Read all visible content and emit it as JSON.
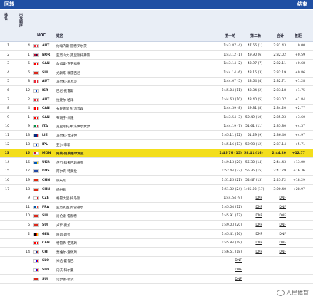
{
  "header": {
    "left_title": "回转",
    "right_title": "结束",
    "col_rank": "排名",
    "col_start": "出发顺序",
    "col_noc": "NOC",
    "col_name": "姓名",
    "col_run1": "第一轮",
    "col_run2": "第二轮",
    "col_total": "合计",
    "col_diff": "差距"
  },
  "rows": [
    {
      "rank": "1",
      "start": "4",
      "noc": "AUT",
      "name": "约翰内斯·施特罗尔茨",
      "run1": "1:43.87 (4)",
      "run2": "47.56 (1)",
      "total": "2:31.43",
      "diff": "0.00",
      "flag": [
        "#ed2939",
        "#ffffff",
        "#ed2939"
      ]
    },
    {
      "rank": "2",
      "start": "1",
      "noc": "NOR",
      "name": "亚历山大·克里斯托弗森",
      "run1": "1:43.12 (1)",
      "run2": "49.90 (6)",
      "total": "2:32.02",
      "diff": "+0.59",
      "flag": [
        "#ba0c2f",
        "#00205b",
        "#ba0c2f"
      ]
    },
    {
      "rank": "3",
      "start": "5",
      "noc": "CAN",
      "name": "詹姆斯·克劳福德",
      "run1": "1:43.14 (2)",
      "run2": "48.97 (7)",
      "total": "2:32.11",
      "diff": "+0.68",
      "flag": [
        "#ff0000",
        "#ffffff",
        "#ff0000"
      ]
    },
    {
      "rank": "4",
      "start": "6",
      "noc": "SUI",
      "name": "尤斯塔·穆雷西尼",
      "run1": "1:44.14 (6)",
      "run2": "48.15 (3)",
      "total": "2:32.19",
      "diff": "+0.86",
      "flag": [
        "#da291c",
        "#da291c",
        "#da291c"
      ]
    },
    {
      "rank": "5",
      "start": "8",
      "noc": "AUT",
      "name": "马尔科·施瓦茨",
      "run1": "1:44.07 (5)",
      "run2": "48.64 (4)",
      "total": "2:32.71",
      "diff": "+1.28",
      "flag": [
        "#ed2939",
        "#ffffff",
        "#ed2939"
      ]
    },
    {
      "rank": "6",
      "start": "12",
      "noc": "ISR",
      "name": "巴尼·托雷斯",
      "run1": "1:45.04 (11)",
      "run2": "48.34 (2)",
      "total": "2:33.18",
      "diff": "+1.75",
      "flag": [
        "#ffffff",
        "#0038b8",
        "#ffffff"
      ]
    },
    {
      "rank": "7",
      "start": "2",
      "noc": "AUT",
      "name": "拉斐尔·哈泽",
      "run1": "1:44.63 (10)",
      "run2": "48.40 (5)",
      "total": "2:33.07",
      "diff": "+1.84",
      "flag": [
        "#ed2939",
        "#ffffff",
        "#ed2939"
      ]
    },
    {
      "rank": "8",
      "start": "4",
      "noc": "CAN",
      "name": "布罗德里克·汤普森",
      "run1": "1:44.39 (8)",
      "run2": "49.81 (8)",
      "total": "2:34.20",
      "diff": "+2.77",
      "flag": [
        "#ff0000",
        "#ffffff",
        "#ff0000"
      ]
    },
    {
      "rank": "9",
      "start": "1",
      "noc": "CAN",
      "name": "布朗宁·佩隆",
      "run1": "1:43.54 (3)",
      "run2": "50.49 (10)",
      "total": "2:35.03",
      "diff": "+3.60",
      "flag": [
        "#ff0000",
        "#ffffff",
        "#ff0000"
      ]
    },
    {
      "rank": "10",
      "start": "9",
      "noc": "ITA",
      "name": "克里斯托弗·法伊尔默尔",
      "run1": "1:44.19 (7)",
      "run2": "51.61 (11)",
      "total": "2:35.80",
      "diff": "+4.37",
      "flag": [
        "#009246",
        "#ffffff",
        "#ce2b37"
      ]
    },
    {
      "rank": "11",
      "start": "13",
      "noc": "LIE",
      "name": "马尔科·普法伊",
      "run1": "1:45.11 (12)",
      "run2": "51.29 (9)",
      "total": "2:36.40",
      "diff": "+4.97",
      "flag": [
        "#002b7f",
        "#002b7f",
        "#ce1126"
      ]
    },
    {
      "rank": "12",
      "start": "18",
      "noc": "IPL",
      "name": "亚尔·菲耶",
      "run1": "1:45.16 (13)",
      "run2": "52.98 (12)",
      "total": "2:37.14",
      "diff": "+5.71",
      "flag": [
        "#ffffff",
        "#0038b8",
        "#ffffff"
      ]
    },
    {
      "rank": "13",
      "start": "15",
      "noc": "MON",
      "name": "阿莱·阿莱维尔泽亚",
      "run1": "1:45.79 (15)",
      "run2": "58.41 (16)",
      "total": "2:44.20",
      "diff": "+12.77",
      "flag": [
        "#ce1126",
        "#ffffff",
        "#ffffff"
      ],
      "highlight": true
    },
    {
      "rank": "14",
      "start": "16",
      "noc": "UKR",
      "name": "伊万·科夫巴斯纽克",
      "run1": "1:49.13 (20)",
      "run2": "55.30 (14)",
      "total": "2:44.43",
      "diff": "+13.00",
      "flag": [
        "#0057b7",
        "#0057b7",
        "#ffd700"
      ]
    },
    {
      "rank": "15",
      "start": "17",
      "noc": "KOS",
      "name": "阿尔宾·特莫拉",
      "run1": "1:52.44 (22)",
      "run2": "55.35 (15)",
      "total": "2:47.79",
      "diff": "+16.36",
      "flag": [
        "#244aa5",
        "#244aa5",
        "#244aa5"
      ]
    },
    {
      "rank": "16",
      "start": "19",
      "noc": "CHN",
      "name": "张天琪",
      "run1": "1:51.25 (21)",
      "run2": "54.47 (13)",
      "total": "2:45.72",
      "diff": "+18.29",
      "flag": [
        "#de2910",
        "#de2910",
        "#de2910"
      ]
    },
    {
      "rank": "17",
      "start": "18",
      "noc": "CHN",
      "name": "杨洪鹏",
      "run1": "1:51.32 (24)",
      "run2": "1:05.08 (17)",
      "total": "3:00.40",
      "diff": "+28.97",
      "flag": [
        "#de2910",
        "#de2910",
        "#de2910"
      ]
    },
    {
      "rank": "",
      "start": "9",
      "noc": "CZE",
      "name": "格雷戈里·托马斯",
      "run1": "1:44.54 (9)",
      "run2": "DNF",
      "total": "DNF",
      "diff": "",
      "flag": [
        "#ffffff",
        "#ffffff",
        "#d7141a"
      ]
    },
    {
      "rank": "",
      "start": "11",
      "noc": "FRA",
      "name": "亚历克西斯·雷德尔",
      "run1": "1:45.04 (12)",
      "run2": "DNF",
      "total": "DNF",
      "diff": "",
      "flag": [
        "#0055a4",
        "#ffffff",
        "#ef4135"
      ]
    },
    {
      "rank": "",
      "start": "10",
      "noc": "SUI",
      "name": "洛伦索·雷赫特",
      "run1": "1:45.91 (17)",
      "run2": "DNF",
      "total": "DNF",
      "diff": "",
      "flag": [
        "#da291c",
        "#da291c",
        "#da291c"
      ]
    },
    {
      "rank": "",
      "start": "5",
      "noc": "SUI",
      "name": "卢卡·蒙加",
      "run1": "1:49.03 (20)",
      "run2": "DNF",
      "total": "DNF",
      "diff": "",
      "flag": [
        "#da291c",
        "#da291c",
        "#da291c"
      ]
    },
    {
      "rank": "",
      "start": "2",
      "noc": "GER",
      "name": "阿努·斯拉",
      "run1": "1:45.41 (16)",
      "run2": "DNF",
      "total": "DNF",
      "diff": "",
      "flag": [
        "#000000",
        "#dd0000",
        "#ffce00"
      ]
    },
    {
      "rank": "",
      "start": "",
      "noc": "CAN",
      "name": "特雷弗·诺克斯",
      "run1": "1:45.84 (19)",
      "run2": "DNF",
      "total": "DNF",
      "diff": "",
      "flag": [
        "#ff0000",
        "#ffffff",
        "#ff0000"
      ]
    },
    {
      "rank": "",
      "start": "14",
      "noc": "CHI",
      "name": "贾维尔·洛佩斯",
      "run1": "1:46.51 (18)",
      "run2": "DNF",
      "total": "DNF",
      "diff": "",
      "flag": [
        "#ffffff",
        "#0039a6",
        "#d52b1e"
      ]
    },
    {
      "rank": "",
      "start": "",
      "noc": "SLO",
      "name": "米哈·霍鲁巴",
      "run1": "DNF",
      "run2": "",
      "total": "",
      "diff": "",
      "flag": [
        "#ffffff",
        "#0000ff",
        "#ff0000"
      ]
    },
    {
      "rank": "",
      "start": "",
      "noc": "SLO",
      "name": "内沃·科尔曼",
      "run1": "DNF",
      "run2": "",
      "total": "",
      "diff": "",
      "flag": [
        "#ffffff",
        "#0000ff",
        "#ff0000"
      ]
    },
    {
      "rank": "",
      "start": "",
      "noc": "SUI",
      "name": "诺尔德·耶茨",
      "run1": "DNF",
      "run2": "",
      "total": "",
      "diff": "",
      "flag": [
        "#da291c",
        "#da291c",
        "#da291c"
      ]
    }
  ],
  "watermark": "人民体育"
}
